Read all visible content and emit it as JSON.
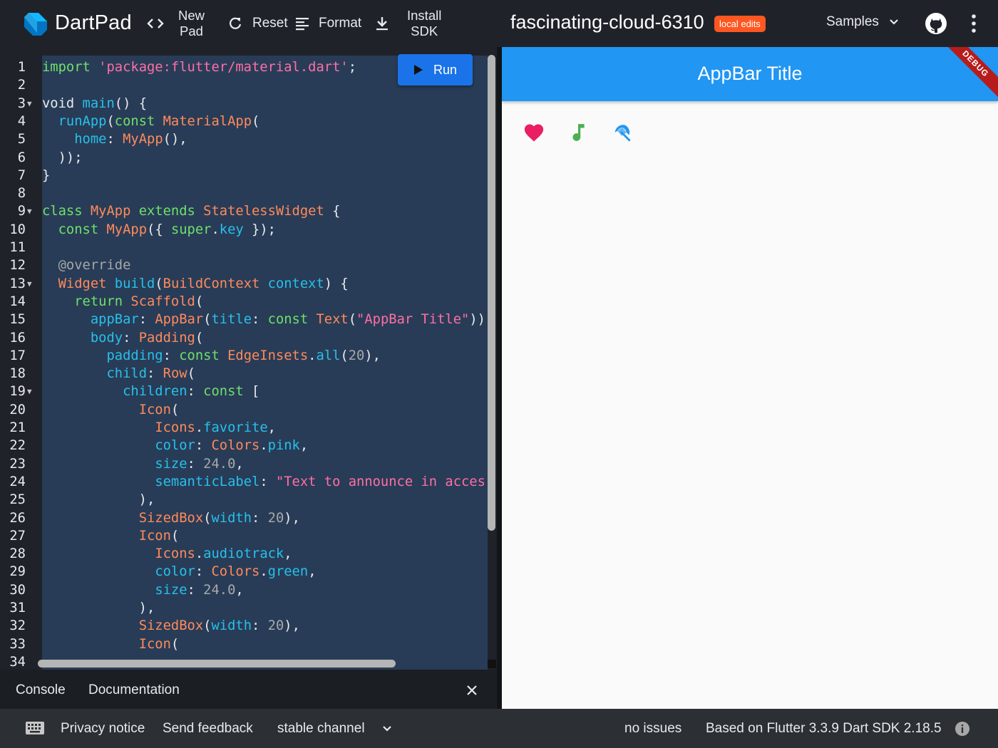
{
  "header": {
    "app_name": "DartPad",
    "new_pad_line1": "New",
    "new_pad_line2": "Pad",
    "reset_label": "Reset",
    "format_label": "Format",
    "install_sdk_line1": "Install",
    "install_sdk_line2": "SDK",
    "pad_title": "fascinating-cloud-6310",
    "badge": "local edits",
    "samples_label": "Samples"
  },
  "editor": {
    "run_label": "Run",
    "lines": [
      {
        "n": "1",
        "fold": false,
        "segs": [
          [
            "k-grn",
            "import "
          ],
          [
            "k-str",
            "'package:flutter/material.dart'"
          ],
          [
            "k-def",
            ";"
          ]
        ]
      },
      {
        "n": "2",
        "fold": false,
        "segs": []
      },
      {
        "n": "3",
        "fold": true,
        "segs": [
          [
            "k-def",
            "void "
          ],
          [
            "k-cyn",
            "main"
          ],
          [
            "k-def",
            "() {"
          ]
        ]
      },
      {
        "n": "4",
        "fold": false,
        "segs": [
          [
            "k-def",
            "  "
          ],
          [
            "k-cyn",
            "runApp"
          ],
          [
            "k-def",
            "("
          ],
          [
            "k-grn",
            "const "
          ],
          [
            "k-org",
            "MaterialApp"
          ],
          [
            "k-def",
            "("
          ]
        ]
      },
      {
        "n": "5",
        "fold": false,
        "segs": [
          [
            "k-def",
            "    "
          ],
          [
            "k-cyn",
            "home"
          ],
          [
            "k-def",
            ": "
          ],
          [
            "k-org",
            "MyApp"
          ],
          [
            "k-def",
            "(),"
          ]
        ]
      },
      {
        "n": "6",
        "fold": false,
        "segs": [
          [
            "k-def",
            "  ));"
          ]
        ]
      },
      {
        "n": "7",
        "fold": false,
        "segs": [
          [
            "k-def",
            "}"
          ]
        ]
      },
      {
        "n": "8",
        "fold": false,
        "segs": []
      },
      {
        "n": "9",
        "fold": true,
        "segs": [
          [
            "k-grn",
            "class "
          ],
          [
            "k-org",
            "MyApp "
          ],
          [
            "k-grn",
            "extends "
          ],
          [
            "k-org",
            "StatelessWidget "
          ],
          [
            "k-def",
            "{"
          ]
        ]
      },
      {
        "n": "10",
        "fold": false,
        "segs": [
          [
            "k-def",
            "  "
          ],
          [
            "k-grn",
            "const "
          ],
          [
            "k-org",
            "MyApp"
          ],
          [
            "k-def",
            "({ "
          ],
          [
            "k-grn",
            "super"
          ],
          [
            "k-def",
            "."
          ],
          [
            "k-cyn",
            "key"
          ],
          [
            "k-def",
            " });"
          ]
        ]
      },
      {
        "n": "11",
        "fold": false,
        "segs": []
      },
      {
        "n": "12",
        "fold": false,
        "segs": [
          [
            "k-def",
            "  "
          ],
          [
            "k-cmt",
            "@override"
          ]
        ]
      },
      {
        "n": "13",
        "fold": true,
        "segs": [
          [
            "k-def",
            "  "
          ],
          [
            "k-org",
            "Widget "
          ],
          [
            "k-cyn",
            "build"
          ],
          [
            "k-def",
            "("
          ],
          [
            "k-org",
            "BuildContext "
          ],
          [
            "k-cyn",
            "context"
          ],
          [
            "k-def",
            ") {"
          ]
        ]
      },
      {
        "n": "14",
        "fold": false,
        "segs": [
          [
            "k-def",
            "    "
          ],
          [
            "k-grn",
            "return "
          ],
          [
            "k-org",
            "Scaffold"
          ],
          [
            "k-def",
            "("
          ]
        ]
      },
      {
        "n": "15",
        "fold": false,
        "segs": [
          [
            "k-def",
            "      "
          ],
          [
            "k-cyn",
            "appBar"
          ],
          [
            "k-def",
            ": "
          ],
          [
            "k-org",
            "AppBar"
          ],
          [
            "k-def",
            "("
          ],
          [
            "k-cyn",
            "title"
          ],
          [
            "k-def",
            ": "
          ],
          [
            "k-grn",
            "const "
          ],
          [
            "k-org",
            "Text"
          ],
          [
            "k-def",
            "("
          ],
          [
            "k-str",
            "\"AppBar Title\""
          ],
          [
            "k-def",
            "))"
          ]
        ]
      },
      {
        "n": "16",
        "fold": false,
        "segs": [
          [
            "k-def",
            "      "
          ],
          [
            "k-cyn",
            "body"
          ],
          [
            "k-def",
            ": "
          ],
          [
            "k-org",
            "Padding"
          ],
          [
            "k-def",
            "("
          ]
        ]
      },
      {
        "n": "17",
        "fold": false,
        "segs": [
          [
            "k-def",
            "        "
          ],
          [
            "k-cyn",
            "padding"
          ],
          [
            "k-def",
            ": "
          ],
          [
            "k-grn",
            "const "
          ],
          [
            "k-org",
            "EdgeInsets"
          ],
          [
            "k-def",
            "."
          ],
          [
            "k-cyn",
            "all"
          ],
          [
            "k-def",
            "("
          ],
          [
            "k-num",
            "20"
          ],
          [
            "k-def",
            "),"
          ]
        ]
      },
      {
        "n": "18",
        "fold": false,
        "segs": [
          [
            "k-def",
            "        "
          ],
          [
            "k-cyn",
            "child"
          ],
          [
            "k-def",
            ": "
          ],
          [
            "k-org",
            "Row"
          ],
          [
            "k-def",
            "("
          ]
        ]
      },
      {
        "n": "19",
        "fold": true,
        "segs": [
          [
            "k-def",
            "          "
          ],
          [
            "k-cyn",
            "children"
          ],
          [
            "k-def",
            ": "
          ],
          [
            "k-grn",
            "const "
          ],
          [
            "k-def",
            "["
          ]
        ]
      },
      {
        "n": "20",
        "fold": false,
        "segs": [
          [
            "k-def",
            "            "
          ],
          [
            "k-org",
            "Icon"
          ],
          [
            "k-def",
            "("
          ]
        ]
      },
      {
        "n": "21",
        "fold": false,
        "segs": [
          [
            "k-def",
            "              "
          ],
          [
            "k-org",
            "Icons"
          ],
          [
            "k-def",
            "."
          ],
          [
            "k-cyn",
            "favorite"
          ],
          [
            "k-def",
            ","
          ]
        ]
      },
      {
        "n": "22",
        "fold": false,
        "segs": [
          [
            "k-def",
            "              "
          ],
          [
            "k-cyn",
            "color"
          ],
          [
            "k-def",
            ": "
          ],
          [
            "k-org",
            "Colors"
          ],
          [
            "k-def",
            "."
          ],
          [
            "k-cyn",
            "pink"
          ],
          [
            "k-def",
            ","
          ]
        ]
      },
      {
        "n": "23",
        "fold": false,
        "segs": [
          [
            "k-def",
            "              "
          ],
          [
            "k-cyn",
            "size"
          ],
          [
            "k-def",
            ": "
          ],
          [
            "k-num",
            "24.0"
          ],
          [
            "k-def",
            ","
          ]
        ]
      },
      {
        "n": "24",
        "fold": false,
        "segs": [
          [
            "k-def",
            "              "
          ],
          [
            "k-cyn",
            "semanticLabel"
          ],
          [
            "k-def",
            ": "
          ],
          [
            "k-str",
            "\"Text to announce in acces"
          ]
        ]
      },
      {
        "n": "25",
        "fold": false,
        "segs": [
          [
            "k-def",
            "            ),"
          ]
        ]
      },
      {
        "n": "26",
        "fold": false,
        "segs": [
          [
            "k-def",
            "            "
          ],
          [
            "k-org",
            "SizedBox"
          ],
          [
            "k-def",
            "("
          ],
          [
            "k-cyn",
            "width"
          ],
          [
            "k-def",
            ": "
          ],
          [
            "k-num",
            "20"
          ],
          [
            "k-def",
            "),"
          ]
        ]
      },
      {
        "n": "27",
        "fold": false,
        "segs": [
          [
            "k-def",
            "            "
          ],
          [
            "k-org",
            "Icon"
          ],
          [
            "k-def",
            "("
          ]
        ]
      },
      {
        "n": "28",
        "fold": false,
        "segs": [
          [
            "k-def",
            "              "
          ],
          [
            "k-org",
            "Icons"
          ],
          [
            "k-def",
            "."
          ],
          [
            "k-cyn",
            "audiotrack"
          ],
          [
            "k-def",
            ","
          ]
        ]
      },
      {
        "n": "29",
        "fold": false,
        "segs": [
          [
            "k-def",
            "              "
          ],
          [
            "k-cyn",
            "color"
          ],
          [
            "k-def",
            ": "
          ],
          [
            "k-org",
            "Colors"
          ],
          [
            "k-def",
            "."
          ],
          [
            "k-cyn",
            "green"
          ],
          [
            "k-def",
            ","
          ]
        ]
      },
      {
        "n": "30",
        "fold": false,
        "segs": [
          [
            "k-def",
            "              "
          ],
          [
            "k-cyn",
            "size"
          ],
          [
            "k-def",
            ": "
          ],
          [
            "k-num",
            "24.0"
          ],
          [
            "k-def",
            ","
          ]
        ]
      },
      {
        "n": "31",
        "fold": false,
        "segs": [
          [
            "k-def",
            "            ),"
          ]
        ]
      },
      {
        "n": "32",
        "fold": false,
        "segs": [
          [
            "k-def",
            "            "
          ],
          [
            "k-org",
            "SizedBox"
          ],
          [
            "k-def",
            "("
          ],
          [
            "k-cyn",
            "width"
          ],
          [
            "k-def",
            ": "
          ],
          [
            "k-num",
            "20"
          ],
          [
            "k-def",
            "),"
          ]
        ]
      },
      {
        "n": "33",
        "fold": false,
        "segs": [
          [
            "k-def",
            "            "
          ],
          [
            "k-org",
            "Icon"
          ],
          [
            "k-def",
            "("
          ]
        ]
      },
      {
        "n": "34",
        "fold": false,
        "segs": []
      }
    ]
  },
  "output": {
    "appbar_title": "AppBar Title",
    "debug_label": "DEBUG",
    "icons": [
      {
        "name": "heart-icon",
        "color": "#e91e63"
      },
      {
        "name": "music-note-icon",
        "color": "#4caf50"
      },
      {
        "name": "beach-umbrella-icon",
        "color": "#2196f3"
      }
    ]
  },
  "console": {
    "tab_console": "Console",
    "tab_documentation": "Documentation"
  },
  "footer": {
    "privacy": "Privacy notice",
    "feedback": "Send feedback",
    "channel": "stable channel",
    "issues": "no issues",
    "version": "Based on Flutter 3.3.9 Dart SDK 2.18.5"
  }
}
